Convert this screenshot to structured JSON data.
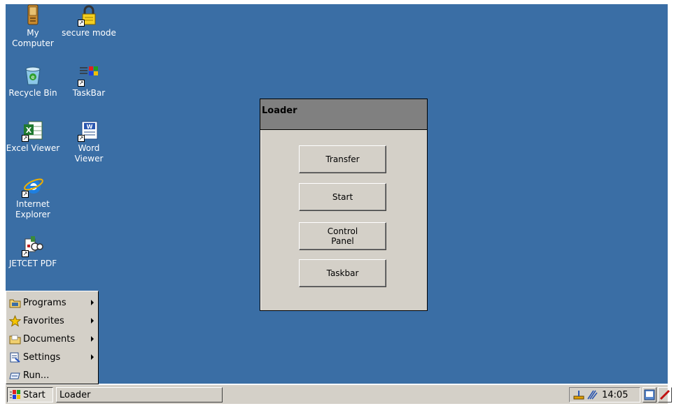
{
  "desktop": {
    "icons": [
      {
        "label": "My\nComputer",
        "icon": "pda-icon"
      },
      {
        "label": "secure mode",
        "icon": "lock-icon"
      },
      {
        "label": "Recycle Bin",
        "icon": "recycle-bin-icon"
      },
      {
        "label": "TaskBar",
        "icon": "taskbar-icon"
      },
      {
        "label": "Excel Viewer",
        "icon": "excel-icon"
      },
      {
        "label": "Word\nViewer",
        "icon": "word-icon"
      },
      {
        "label": "Internet\nExplorer",
        "icon": "internet-explorer-icon"
      },
      {
        "label": "JETCET PDF",
        "icon": "pdf-icon"
      }
    ]
  },
  "loader": {
    "title": "Loader",
    "buttons": {
      "transfer": "Transfer",
      "start": "Start",
      "control_panel": "Control\nPanel",
      "taskbar": "Taskbar"
    }
  },
  "start_menu": {
    "programs": "Programs",
    "favorites": "Favorites",
    "documents": "Documents",
    "settings": "Settings",
    "run": "Run..."
  },
  "taskbar": {
    "start_label": "Start",
    "task_loader": "Loader",
    "clock": "14:05"
  },
  "colors": {
    "desktop": "#3a6ea5",
    "chrome": "#d4d0c8",
    "title_bar": "#808080"
  }
}
